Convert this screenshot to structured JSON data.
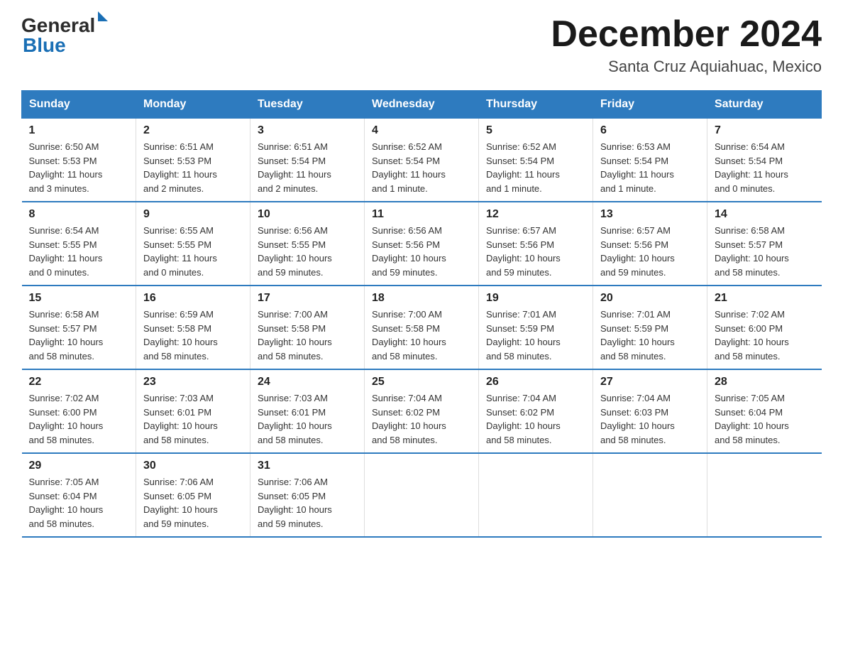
{
  "logo": {
    "general": "General",
    "blue": "Blue"
  },
  "title": "December 2024",
  "location": "Santa Cruz Aquiahuac, Mexico",
  "days_header": [
    "Sunday",
    "Monday",
    "Tuesday",
    "Wednesday",
    "Thursday",
    "Friday",
    "Saturday"
  ],
  "weeks": [
    [
      {
        "day": "1",
        "info": "Sunrise: 6:50 AM\nSunset: 5:53 PM\nDaylight: 11 hours\nand 3 minutes."
      },
      {
        "day": "2",
        "info": "Sunrise: 6:51 AM\nSunset: 5:53 PM\nDaylight: 11 hours\nand 2 minutes."
      },
      {
        "day": "3",
        "info": "Sunrise: 6:51 AM\nSunset: 5:54 PM\nDaylight: 11 hours\nand 2 minutes."
      },
      {
        "day": "4",
        "info": "Sunrise: 6:52 AM\nSunset: 5:54 PM\nDaylight: 11 hours\nand 1 minute."
      },
      {
        "day": "5",
        "info": "Sunrise: 6:52 AM\nSunset: 5:54 PM\nDaylight: 11 hours\nand 1 minute."
      },
      {
        "day": "6",
        "info": "Sunrise: 6:53 AM\nSunset: 5:54 PM\nDaylight: 11 hours\nand 1 minute."
      },
      {
        "day": "7",
        "info": "Sunrise: 6:54 AM\nSunset: 5:54 PM\nDaylight: 11 hours\nand 0 minutes."
      }
    ],
    [
      {
        "day": "8",
        "info": "Sunrise: 6:54 AM\nSunset: 5:55 PM\nDaylight: 11 hours\nand 0 minutes."
      },
      {
        "day": "9",
        "info": "Sunrise: 6:55 AM\nSunset: 5:55 PM\nDaylight: 11 hours\nand 0 minutes."
      },
      {
        "day": "10",
        "info": "Sunrise: 6:56 AM\nSunset: 5:55 PM\nDaylight: 10 hours\nand 59 minutes."
      },
      {
        "day": "11",
        "info": "Sunrise: 6:56 AM\nSunset: 5:56 PM\nDaylight: 10 hours\nand 59 minutes."
      },
      {
        "day": "12",
        "info": "Sunrise: 6:57 AM\nSunset: 5:56 PM\nDaylight: 10 hours\nand 59 minutes."
      },
      {
        "day": "13",
        "info": "Sunrise: 6:57 AM\nSunset: 5:56 PM\nDaylight: 10 hours\nand 59 minutes."
      },
      {
        "day": "14",
        "info": "Sunrise: 6:58 AM\nSunset: 5:57 PM\nDaylight: 10 hours\nand 58 minutes."
      }
    ],
    [
      {
        "day": "15",
        "info": "Sunrise: 6:58 AM\nSunset: 5:57 PM\nDaylight: 10 hours\nand 58 minutes."
      },
      {
        "day": "16",
        "info": "Sunrise: 6:59 AM\nSunset: 5:58 PM\nDaylight: 10 hours\nand 58 minutes."
      },
      {
        "day": "17",
        "info": "Sunrise: 7:00 AM\nSunset: 5:58 PM\nDaylight: 10 hours\nand 58 minutes."
      },
      {
        "day": "18",
        "info": "Sunrise: 7:00 AM\nSunset: 5:58 PM\nDaylight: 10 hours\nand 58 minutes."
      },
      {
        "day": "19",
        "info": "Sunrise: 7:01 AM\nSunset: 5:59 PM\nDaylight: 10 hours\nand 58 minutes."
      },
      {
        "day": "20",
        "info": "Sunrise: 7:01 AM\nSunset: 5:59 PM\nDaylight: 10 hours\nand 58 minutes."
      },
      {
        "day": "21",
        "info": "Sunrise: 7:02 AM\nSunset: 6:00 PM\nDaylight: 10 hours\nand 58 minutes."
      }
    ],
    [
      {
        "day": "22",
        "info": "Sunrise: 7:02 AM\nSunset: 6:00 PM\nDaylight: 10 hours\nand 58 minutes."
      },
      {
        "day": "23",
        "info": "Sunrise: 7:03 AM\nSunset: 6:01 PM\nDaylight: 10 hours\nand 58 minutes."
      },
      {
        "day": "24",
        "info": "Sunrise: 7:03 AM\nSunset: 6:01 PM\nDaylight: 10 hours\nand 58 minutes."
      },
      {
        "day": "25",
        "info": "Sunrise: 7:04 AM\nSunset: 6:02 PM\nDaylight: 10 hours\nand 58 minutes."
      },
      {
        "day": "26",
        "info": "Sunrise: 7:04 AM\nSunset: 6:02 PM\nDaylight: 10 hours\nand 58 minutes."
      },
      {
        "day": "27",
        "info": "Sunrise: 7:04 AM\nSunset: 6:03 PM\nDaylight: 10 hours\nand 58 minutes."
      },
      {
        "day": "28",
        "info": "Sunrise: 7:05 AM\nSunset: 6:04 PM\nDaylight: 10 hours\nand 58 minutes."
      }
    ],
    [
      {
        "day": "29",
        "info": "Sunrise: 7:05 AM\nSunset: 6:04 PM\nDaylight: 10 hours\nand 58 minutes."
      },
      {
        "day": "30",
        "info": "Sunrise: 7:06 AM\nSunset: 6:05 PM\nDaylight: 10 hours\nand 59 minutes."
      },
      {
        "day": "31",
        "info": "Sunrise: 7:06 AM\nSunset: 6:05 PM\nDaylight: 10 hours\nand 59 minutes."
      },
      {
        "day": "",
        "info": ""
      },
      {
        "day": "",
        "info": ""
      },
      {
        "day": "",
        "info": ""
      },
      {
        "day": "",
        "info": ""
      }
    ]
  ]
}
